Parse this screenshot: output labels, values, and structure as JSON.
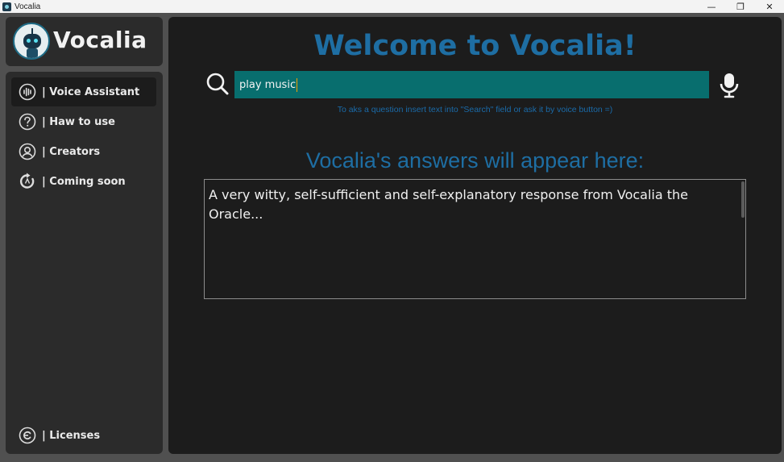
{
  "window": {
    "title": "Vocalia",
    "controls": {
      "minimize": "—",
      "restore": "❐",
      "close": "✕"
    }
  },
  "logo": {
    "text": "Vocalia",
    "icon": "robot-logo"
  },
  "sidebar": {
    "items": [
      {
        "label": "| Voice Assistant",
        "icon": "voice-wave-icon",
        "active": true
      },
      {
        "label": "| Haw to use",
        "icon": "question-icon",
        "active": false
      },
      {
        "label": "| Creators",
        "icon": "user-circle-icon",
        "active": false
      },
      {
        "label": "| Coming soon",
        "icon": "refresh-icon",
        "active": false
      }
    ],
    "footer_item": {
      "label": "| Licenses",
      "icon": "license-icon"
    }
  },
  "main": {
    "welcome": "Welcome to Vocalia!",
    "search": {
      "value": "play music",
      "placeholder": ""
    },
    "hint": "To aks a question insert text into \"Search\" field or ask it by voice button =)",
    "answers_title": "Vocalia's answers will appear here:",
    "answer_text": "A very witty, self-sufficient and self-explanatory response from Vocalia the Oracle..."
  },
  "colors": {
    "accent": "#1e6ea3",
    "input_bg": "#086e6e",
    "panel_bg": "#2b2b2b",
    "main_bg": "#1c1c1c"
  }
}
